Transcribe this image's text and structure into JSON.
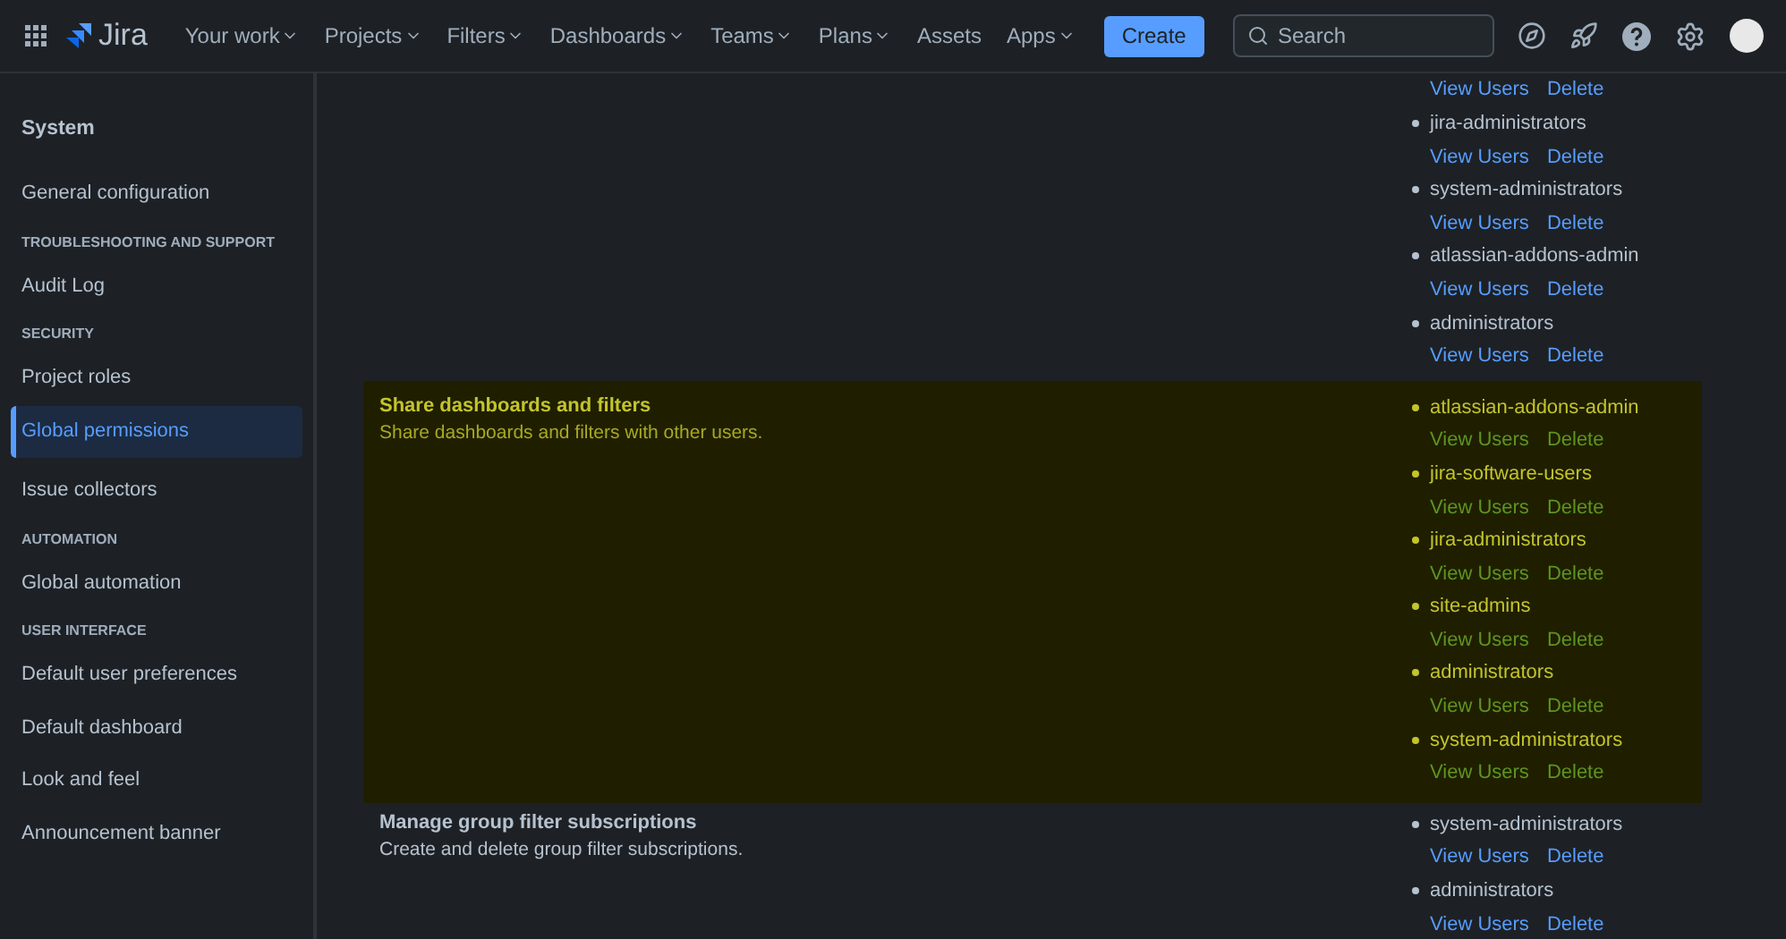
{
  "topbar": {
    "product": "Jira",
    "nav": [
      {
        "label": "Your work",
        "dropdown": true
      },
      {
        "label": "Projects",
        "dropdown": true
      },
      {
        "label": "Filters",
        "dropdown": true
      },
      {
        "label": "Dashboards",
        "dropdown": true
      },
      {
        "label": "Teams",
        "dropdown": true
      },
      {
        "label": "Plans",
        "dropdown": true
      },
      {
        "label": "Assets",
        "dropdown": false
      },
      {
        "label": "Apps",
        "dropdown": true
      }
    ],
    "create": "Create",
    "search": {
      "placeholder": "Search"
    }
  },
  "sidebar": {
    "title": "System",
    "sections": [
      {
        "items": [
          {
            "label": "General configuration",
            "selected": false
          }
        ]
      },
      {
        "heading": "TROUBLESHOOTING AND SUPPORT",
        "items": [
          {
            "label": "Audit Log",
            "selected": false
          }
        ]
      },
      {
        "heading": "SECURITY",
        "items": [
          {
            "label": "Project roles",
            "selected": false
          },
          {
            "label": "Global permissions",
            "selected": true
          },
          {
            "label": "Issue collectors",
            "selected": false
          }
        ]
      },
      {
        "heading": "AUTOMATION",
        "items": [
          {
            "label": "Global automation",
            "selected": false
          }
        ]
      },
      {
        "heading": "USER INTERFACE",
        "items": [
          {
            "label": "Default user preferences",
            "selected": false
          },
          {
            "label": "Default dashboard",
            "selected": false
          },
          {
            "label": "Look and feel",
            "selected": false
          },
          {
            "label": "Announcement banner",
            "selected": false
          }
        ]
      }
    ]
  },
  "permissions": [
    {
      "highlighted": false,
      "groups": [
        {
          "view": "View Users",
          "delete": "Delete"
        },
        {
          "name": "jira-administrators",
          "view": "View Users",
          "delete": "Delete"
        },
        {
          "name": "system-administrators",
          "view": "View Users",
          "delete": "Delete"
        },
        {
          "name": "atlassian-addons-admin",
          "view": "View Users",
          "delete": "Delete"
        },
        {
          "name": "administrators",
          "view": "View Users",
          "delete": "Delete"
        }
      ]
    },
    {
      "highlighted": true,
      "title": "Share dashboards and filters",
      "description": "Share dashboards and filters with other users.",
      "groups": [
        {
          "name": "atlassian-addons-admin",
          "view": "View Users",
          "delete": "Delete"
        },
        {
          "name": "jira-software-users",
          "view": "View Users",
          "delete": "Delete"
        },
        {
          "name": "jira-administrators",
          "view": "View Users",
          "delete": "Delete"
        },
        {
          "name": "site-admins",
          "view": "View Users",
          "delete": "Delete"
        },
        {
          "name": "administrators",
          "view": "View Users",
          "delete": "Delete"
        },
        {
          "name": "system-administrators",
          "view": "View Users",
          "delete": "Delete"
        }
      ]
    },
    {
      "highlighted": false,
      "title": "Manage group filter subscriptions",
      "description": "Create and delete group filter subscriptions.",
      "groups": [
        {
          "name": "system-administrators",
          "view": "View Users",
          "delete": "Delete"
        },
        {
          "name": "administrators",
          "view": "View Users",
          "delete": "Delete"
        }
      ]
    }
  ]
}
